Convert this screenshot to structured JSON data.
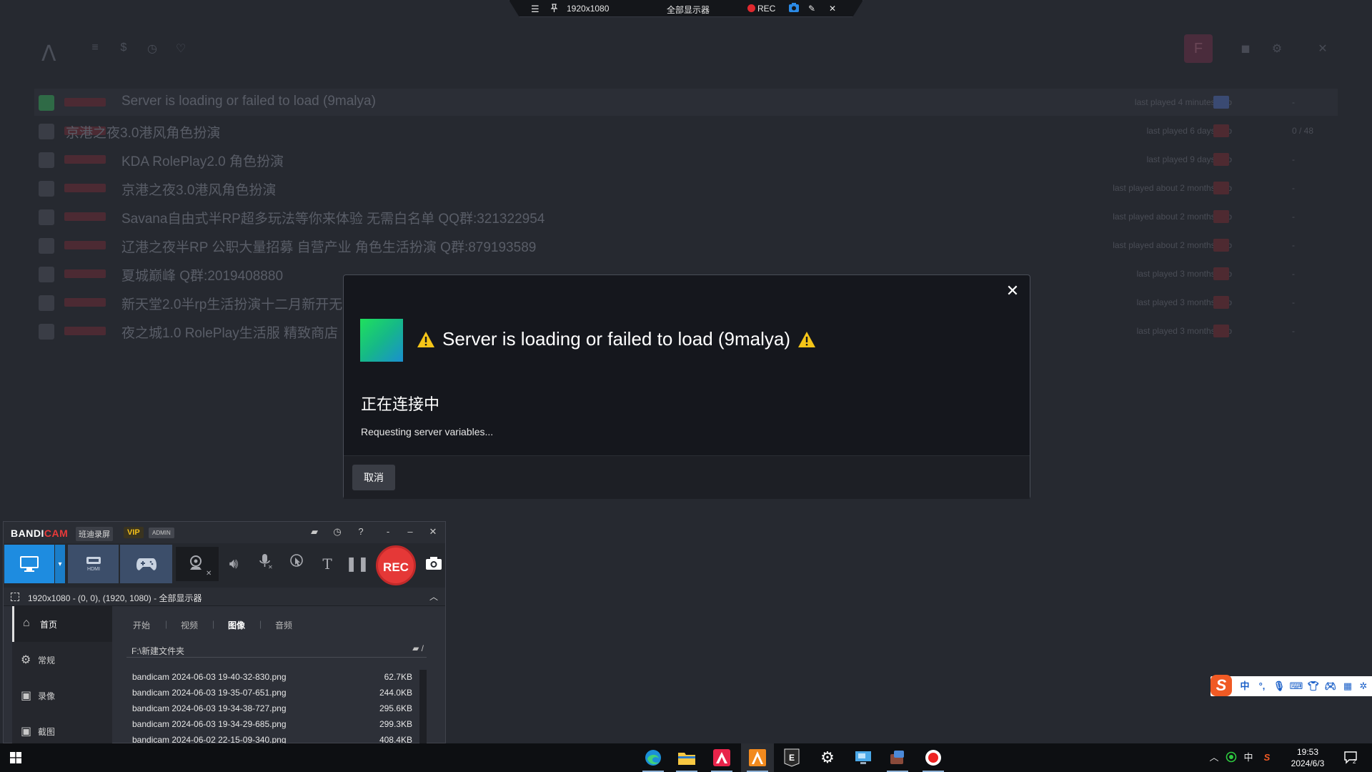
{
  "background_app": {
    "rows": [
      {
        "name": "Server is loading or failed to load (9malya)",
        "desc": "",
        "last_played": "last played 4 minutes ago",
        "count": "-"
      },
      {
        "name": "京港之夜3.0港风角色扮演",
        "desc": "",
        "last_played": "last played 6 days ago",
        "count": "0 / 48"
      },
      {
        "name": "KDA RolePlay2.0 角色扮演",
        "desc": "",
        "last_played": "last played 9 days ago",
        "count": "-"
      },
      {
        "name": "京港之夜3.0港风角色扮演",
        "desc": "",
        "last_played": "last played about 2 months ago",
        "count": "-"
      },
      {
        "name": "Savana自由式半RP超多玩法等你来体验 无需白名单 QQ群:321322954",
        "desc": "",
        "last_played": "last played about 2 months ago",
        "count": "-"
      },
      {
        "name": "辽港之夜半RP 公职大量招募 自营产业 角色生活扮演 Q群:879193589",
        "desc": "",
        "last_played": "last played about 2 months ago",
        "count": "-"
      },
      {
        "name": "夏城巅峰 Q群:2019408880",
        "desc": "",
        "last_played": "last played 3 months ago",
        "count": "-"
      },
      {
        "name": "新天堂2.0半rp生活扮演十二月新开无",
        "desc": "",
        "last_played": "last played 3 months ago",
        "count": "-"
      },
      {
        "name": "夜之城1.0 RolePlay生活服 精致商店",
        "desc": "",
        "last_played": "last played 3 months ago",
        "count": "-"
      }
    ]
  },
  "recbar": {
    "resolution": "1920x1080",
    "display": "全部显示器",
    "rec_label": "REC"
  },
  "modal": {
    "title": "Server is loading or failed to load (9malya)",
    "status": "正在连接中",
    "detail": "Requesting server variables...",
    "cancel_label": "取消",
    "close_glyph": "✕"
  },
  "bandicam": {
    "logo_a": "BANDI",
    "logo_b": "CAM",
    "cn_name": "班迪录屏",
    "vip": "VIP",
    "admin": "ADMIN",
    "hdmi_label": "HDMI",
    "rec_label": "REC",
    "region": "1920x1080 - (0, 0), (1920, 1080) - 全部显示器",
    "side_items": [
      {
        "label": "首页",
        "icon": "home-icon",
        "glyph": "⌂"
      },
      {
        "label": "常规",
        "icon": "gear-icon",
        "glyph": "⚙"
      },
      {
        "label": "录像",
        "icon": "video-settings-icon",
        "glyph": "▣"
      },
      {
        "label": "截图",
        "icon": "screenshot-settings-icon",
        "glyph": "▣"
      }
    ],
    "tabs": [
      "开始",
      "视频",
      "图像",
      "音频"
    ],
    "active_tab": "图像",
    "path": "F:\\新建文件夹",
    "path_icon_suffix": "/",
    "files": [
      {
        "name": "bandicam 2024-06-03 19-40-32-830.png",
        "size": "62.7KB"
      },
      {
        "name": "bandicam 2024-06-03 19-35-07-651.png",
        "size": "244.0KB"
      },
      {
        "name": "bandicam 2024-06-03 19-34-38-727.png",
        "size": "295.6KB"
      },
      {
        "name": "bandicam 2024-06-03 19-34-29-685.png",
        "size": "299.3KB"
      },
      {
        "name": "bandicam 2024-06-02 22-15-09-340.png",
        "size": "408.4KB"
      }
    ]
  },
  "ime": {
    "logo": "S",
    "lang": "中"
  },
  "taskbar": {
    "apps": [
      "edge-icon",
      "file-explorer-icon",
      "a-app-icon",
      "launcher-icon",
      "epic-games-icon",
      "settings-icon",
      "remote-desktop-icon",
      "app-icon",
      "bandicam-record-icon"
    ],
    "ime_lang": "中",
    "time": "19:53",
    "date": "2024/6/3"
  },
  "colors": {
    "accent_blue": "#1e8ce0",
    "rec_red": "#e53837",
    "warning_yellow": "#f5c518"
  }
}
